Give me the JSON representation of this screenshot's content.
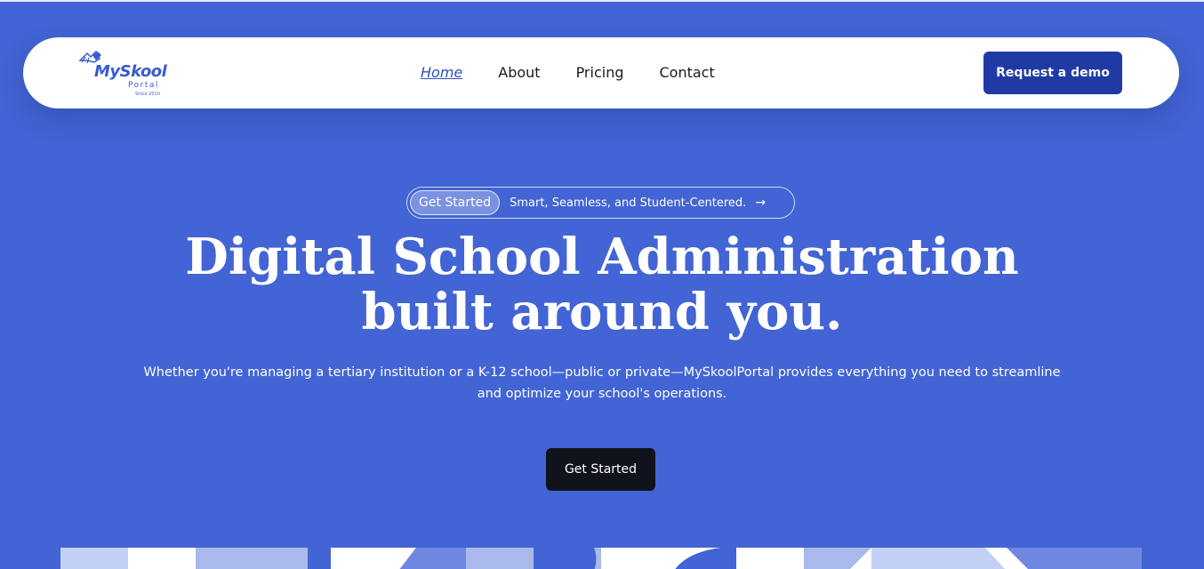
{
  "brand": {
    "name": "MySkool",
    "sub": "Portal",
    "since": "Since 2010",
    "color": "#3a5bcf"
  },
  "nav": {
    "items": [
      {
        "label": "Home",
        "active": true
      },
      {
        "label": "About",
        "active": false
      },
      {
        "label": "Pricing",
        "active": false
      },
      {
        "label": "Contact",
        "active": false
      }
    ],
    "cta": "Request a demo"
  },
  "hero": {
    "pill_tag": "Get Started",
    "pill_text": "Smart, Seamless, and Student-Centered.",
    "pill_arrow": "→",
    "title_line1": "Digital School Administration",
    "title_line2": "built around you.",
    "description": "Whether you're managing a tertiary institution or a K-12 school—public or private—MySkoolPortal provides everything you need to streamline and optimize your school's operations.",
    "cta": "Get Started"
  },
  "colors": {
    "background": "#4264d4",
    "nav_bg": "#ffffff",
    "demo_button": "#1f3aa5",
    "cta_button": "#11131c",
    "pattern_light": "#c3d0f6",
    "pattern_mid": "#aab9ec",
    "pattern_dark": "#6f87e0"
  }
}
